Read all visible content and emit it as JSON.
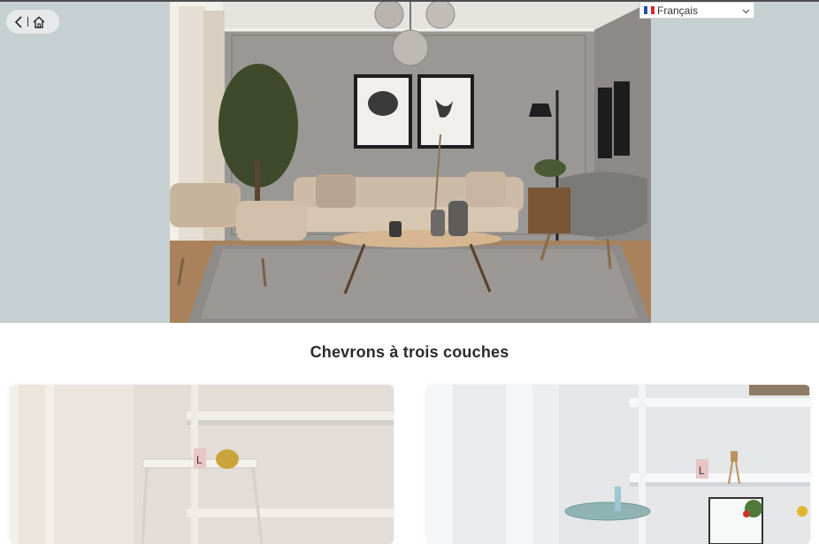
{
  "language_selector": {
    "label": "Français",
    "icon": "chevron-down-icon"
  },
  "nav": {
    "back_icon": "back-arrow-icon",
    "home_icon": "home-icon"
  },
  "section": {
    "title": "Chevrons à trois couches"
  },
  "colors": {
    "hero_bg": "#c6cfd1",
    "title": "#2b2b2b",
    "page_bg": "#ffffff"
  }
}
